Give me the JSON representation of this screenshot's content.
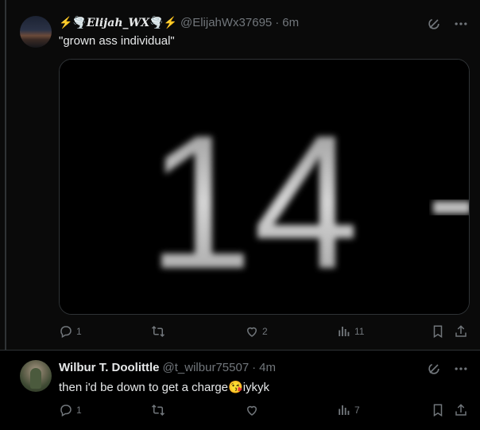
{
  "tweets": [
    {
      "display_name_prefix_emoji": "⚡🌪️",
      "display_name": "Elijah_WX",
      "display_name_suffix_emoji": "🌪️⚡",
      "handle": "@ElijahWx37695",
      "separator": "·",
      "time": "6m",
      "text": "\"grown ass individual\"",
      "media_text": "14",
      "stats": {
        "replies": "1",
        "reposts": "",
        "likes": "2",
        "views": "11"
      },
      "icons": [
        "grok-icon",
        "more-icon",
        "reply-icon",
        "retweet-icon",
        "like-icon",
        "views-icon",
        "bookmark-icon",
        "share-icon"
      ]
    },
    {
      "display_name": "Wilbur T. Doolittle",
      "handle": "@t_wilbur75507",
      "separator": "·",
      "time": "4m",
      "text": "then i'd be down to get a charge😘iykyk",
      "stats": {
        "replies": "1",
        "reposts": "",
        "likes": "",
        "views": "7"
      },
      "icons": [
        "grok-icon",
        "more-icon",
        "reply-icon",
        "retweet-icon",
        "like-icon",
        "views-icon",
        "bookmark-icon",
        "share-icon"
      ]
    }
  ],
  "colors": {
    "background": "#000000",
    "text": "#e7e9ea",
    "muted": "#71767b",
    "border": "#2f3336"
  }
}
